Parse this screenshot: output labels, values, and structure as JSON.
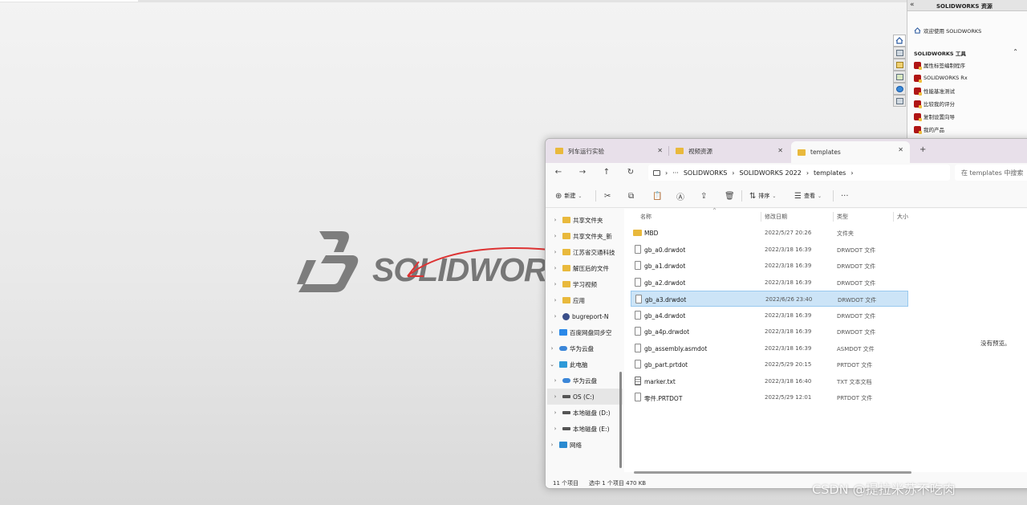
{
  "task_pane": {
    "collapse_glyph": "«",
    "title": "SOLIDWORKS 资源",
    "welcome": "欢迎使用 SOLIDWORKS",
    "tools_section": "SOLIDWORKS 工具",
    "tools": [
      {
        "label": "属性标签编制程序"
      },
      {
        "label": "SOLIDWORKS Rx"
      },
      {
        "label": "性能基准测试"
      },
      {
        "label": "比较我的评分"
      },
      {
        "label": "复制设置向导"
      },
      {
        "label": "我的产品"
      }
    ]
  },
  "logo": {
    "text": "SOLIDWORKS"
  },
  "explorer": {
    "tabs": [
      {
        "label": "列车运行实验"
      },
      {
        "label": "视频资源"
      },
      {
        "label": "templates"
      }
    ],
    "new_tab_glyph": "+",
    "address": {
      "more": "···",
      "crumbs": [
        "SOLIDWORKS",
        "SOLIDWORKS 2022",
        "templates"
      ],
      "sep": "›"
    },
    "search_placeholder": "在 templates 中搜索",
    "toolbar": {
      "new_label": "新建",
      "sort_label": "排序",
      "view_label": "查看",
      "more_glyph": "···"
    },
    "nav": [
      {
        "label": "共享文件夹",
        "icon": "folder-icon"
      },
      {
        "label": "共享文件夹_新",
        "icon": "folder-icon"
      },
      {
        "label": "江苏省交通科技",
        "icon": "folder-icon"
      },
      {
        "label": "解压后的文件",
        "icon": "folder-icon"
      },
      {
        "label": "学习视频",
        "icon": "folder-icon"
      },
      {
        "label": "应用",
        "icon": "folder-icon"
      },
      {
        "label": "bugreport-N",
        "icon": "bug-icon"
      },
      {
        "label": "百度网盘同步空",
        "icon": "baidu-icon"
      },
      {
        "label": "华为云盘",
        "icon": "cloud-icon"
      },
      {
        "label": "此电脑",
        "icon": "pc-icon"
      },
      {
        "label": "华为云盘",
        "icon": "cloud-icon"
      },
      {
        "label": "OS (C:)",
        "icon": "drive-icon"
      },
      {
        "label": "本地磁盘 (D:)",
        "icon": "drive-icon"
      },
      {
        "label": "本地磁盘 (E:)",
        "icon": "drive-icon"
      },
      {
        "label": "网络",
        "icon": "network-icon"
      }
    ],
    "columns": {
      "name": "名称",
      "date": "修改日期",
      "type": "类型",
      "size": "大小"
    },
    "files": [
      {
        "name": "MBD",
        "date": "2022/5/27 20:26",
        "type": "文件夹"
      },
      {
        "name": "gb_a0.drwdot",
        "date": "2022/3/18 16:39",
        "type": "DRWDOT 文件"
      },
      {
        "name": "gb_a1.drwdot",
        "date": "2022/3/18 16:39",
        "type": "DRWDOT 文件"
      },
      {
        "name": "gb_a2.drwdot",
        "date": "2022/3/18 16:39",
        "type": "DRWDOT 文件"
      },
      {
        "name": "gb_a3.drwdot",
        "date": "2022/6/26 23:40",
        "type": "DRWDOT 文件"
      },
      {
        "name": "gb_a4.drwdot",
        "date": "2022/3/18 16:39",
        "type": "DRWDOT 文件"
      },
      {
        "name": "gb_a4p.drwdot",
        "date": "2022/3/18 16:39",
        "type": "DRWDOT 文件"
      },
      {
        "name": "gb_assembly.asmdot",
        "date": "2022/3/18 16:39",
        "type": "ASMDOT 文件"
      },
      {
        "name": "gb_part.prtdot",
        "date": "2022/5/29 20:15",
        "type": "PRTDOT 文件"
      },
      {
        "name": "marker.txt",
        "date": "2022/3/18 16:40",
        "type": "TXT 文本文档"
      },
      {
        "name": "零件.PRTDOT",
        "date": "2022/5/29 12:01",
        "type": "PRTDOT 文件"
      }
    ],
    "status": {
      "count": "11 个项目",
      "selection": "选中 1 个项目  470 KB"
    }
  },
  "preview_text": "没有预览。",
  "watermark": "CSDN @提拉米苏不吃肉"
}
